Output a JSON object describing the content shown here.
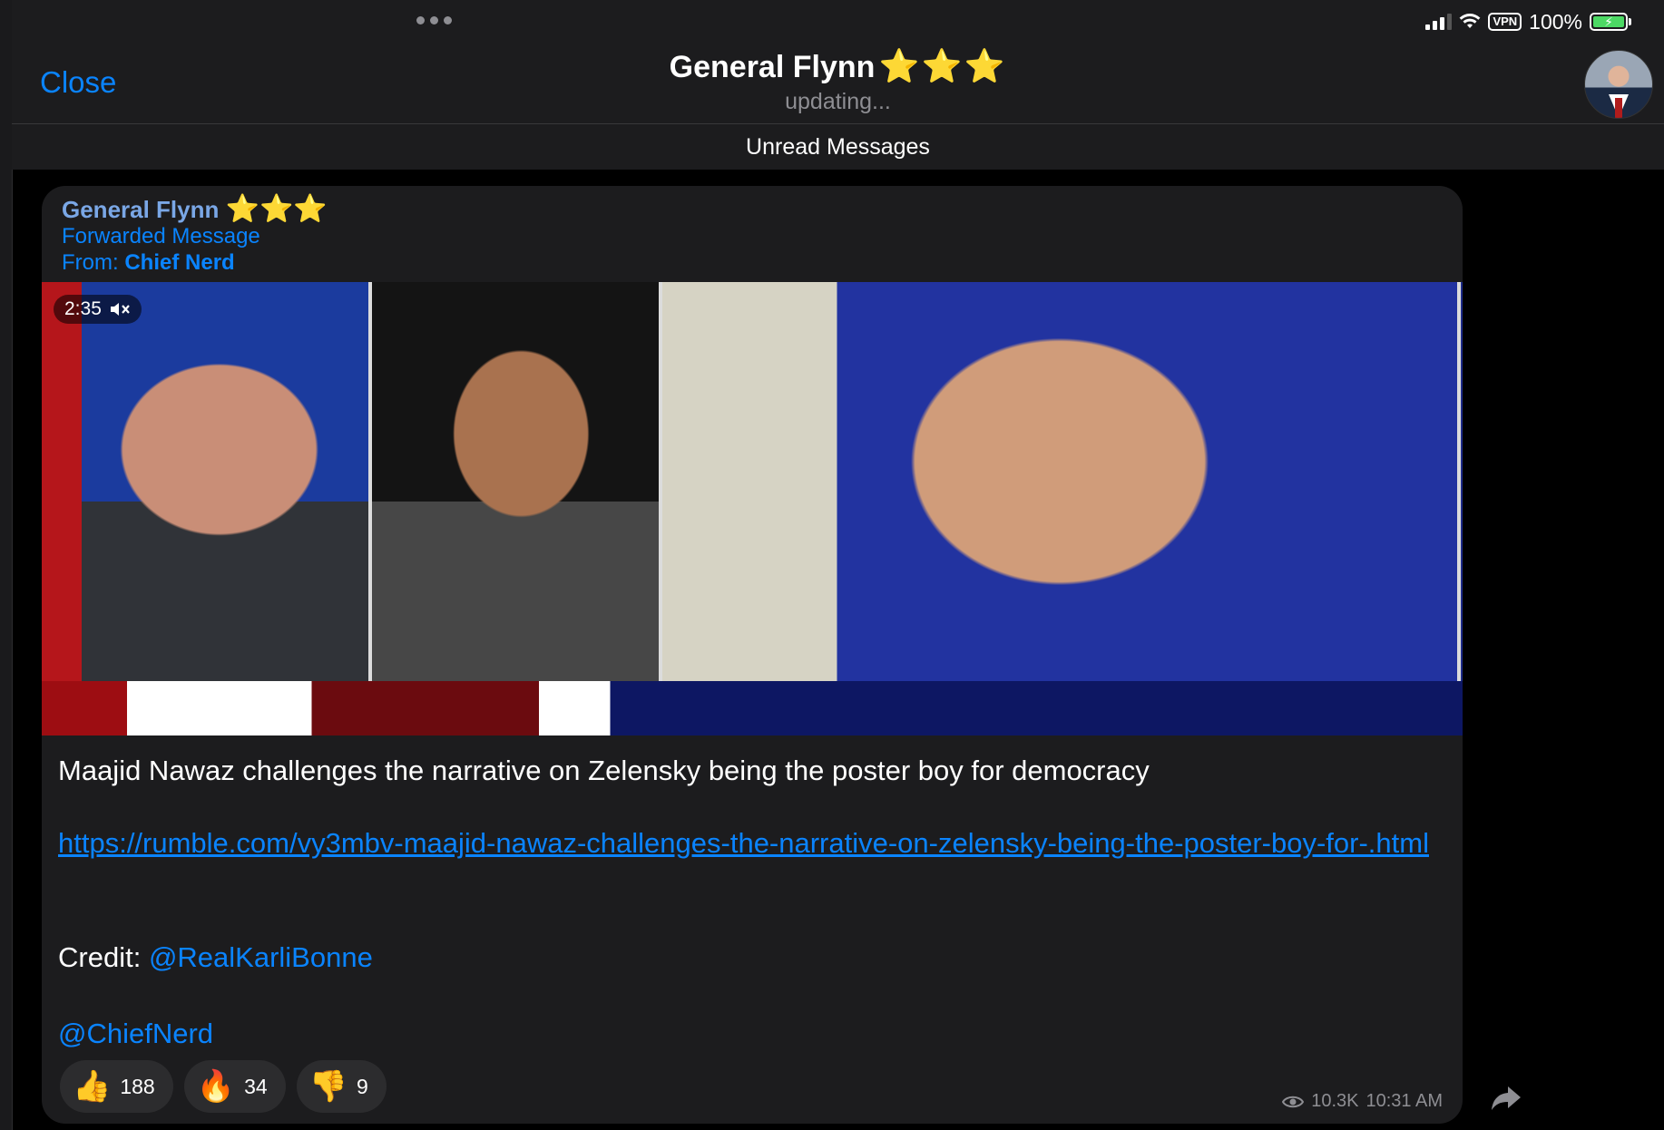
{
  "status_bar": {
    "vpn": "VPN",
    "battery": "100%",
    "battery_level": 1.0,
    "signal_bars_filled": 3,
    "signal_bars_total": 4
  },
  "header": {
    "close_label": "Close",
    "title": "General Flynn",
    "title_stars": "⭐⭐⭐",
    "status": "updating..."
  },
  "unread_label": "Unread Messages",
  "message": {
    "sender": "General Flynn",
    "sender_stars": "⭐⭐⭐",
    "forwarded_label": "Forwarded Message",
    "from_prefix": "From:",
    "from_name": "Chief Nerd",
    "video_duration": "2:35",
    "muted_icon": "speaker-muted-icon",
    "text": "Maajid Nawaz challenges the narrative on Zelensky being the poster boy for democracy",
    "link": "https://rumble.com/vy3mbv-maajid-nawaz-challenges-the-narrative-on-zelensky-being-the-poster-boy-for-.html",
    "credit_label": "Credit:",
    "credit_mention": "@RealKarliBonne",
    "channel_mention": "@ChiefNerd",
    "reactions": [
      {
        "emoji": "👍",
        "count": "188"
      },
      {
        "emoji": "🔥",
        "count": "34"
      },
      {
        "emoji": "👎",
        "count": "9"
      }
    ],
    "views": "10.3K",
    "time": "10:31 AM"
  },
  "colors": {
    "accent": "#0a84ff",
    "background": "#000000",
    "bubble": "#1c1c1e",
    "star": "#ffcc00",
    "battery": "#4cd964"
  }
}
